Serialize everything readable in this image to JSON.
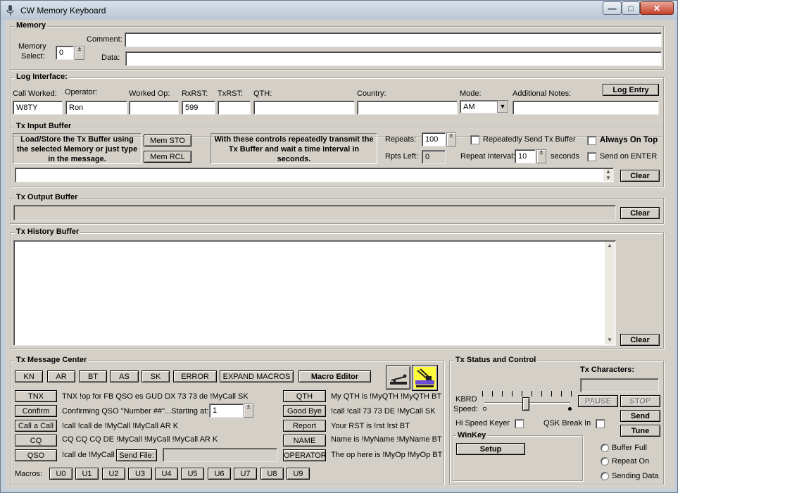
{
  "window": {
    "title": "CW Memory Keyboard",
    "minimize_glyph": "—",
    "maximize_glyph": "□",
    "close_glyph": "✕"
  },
  "memory": {
    "group_label": "Memory",
    "select_label_line1": "Memory",
    "select_label_line2": "Select:",
    "select_value": "0",
    "comment_label": "Comment:",
    "comment_value": "",
    "data_label": "Data:",
    "data_value": ""
  },
  "log": {
    "group_label": "Log Interface:",
    "log_entry_label": "Log Entry",
    "fields": {
      "call_worked_label": "Call Worked:",
      "call_worked_value": "W8TY",
      "operator_label": "Operator:",
      "operator_value": "Ron",
      "worked_op_label": "Worked Op:",
      "worked_op_value": "",
      "rxrst_label": "RxRST:",
      "rxrst_value": "599",
      "txrst_label": "TxRST:",
      "txrst_value": "",
      "qth_label": "QTH:",
      "qth_value": "",
      "country_label": "Country:",
      "country_value": "",
      "mode_label": "Mode:",
      "mode_value": "AM",
      "notes_label": "Additional Notes:",
      "notes_value": ""
    }
  },
  "tx_input": {
    "group_label": "Tx Input Buffer",
    "help_text": "Load/Store the Tx Buffer using the selected Memory  or just type in the message.",
    "mem_sto_label": "Mem STO",
    "mem_rcl_label": "Mem RCL",
    "repeat_help": "With these controls repeatedly transmit the Tx Buffer and wait a time interval in seconds.",
    "repeats_label": "Repeats:",
    "repeats_value": "100",
    "rpts_left_label": "Rpts Left:",
    "rpts_left_value": "0",
    "repeat_send_label": "Repeatedly Send Tx Buffer",
    "repeat_interval_label": "Repeat Interval:",
    "repeat_interval_value": "10",
    "seconds_label": "seconds",
    "always_on_top_label": "Always On Top",
    "send_on_enter_label": "Send on ENTER",
    "buffer_value": "",
    "clear_label": "Clear"
  },
  "tx_output": {
    "group_label": "Tx Output Buffer",
    "buffer_value": "",
    "clear_label": "Clear"
  },
  "tx_history": {
    "group_label": "Tx History Buffer",
    "buffer_value": "",
    "clear_label": "Clear"
  },
  "message_center": {
    "group_label": "Tx Message Center",
    "prosigns": [
      "KN",
      "AR",
      "BT",
      "AS",
      "SK",
      "ERROR",
      "EXPAND MACROS"
    ],
    "macro_editor_label": "Macro Editor",
    "left_messages": [
      {
        "button": "TNX",
        "text": "TNX !op for FB QSO es GUD DX 73 73  de !MyCall SK"
      },
      {
        "button": "Confirm",
        "text": "Confirming QSO \"Number ##\"...Starting at:"
      },
      {
        "button": "Call a Call",
        "text": "!call !call de !MyCall !MyCall AR K"
      },
      {
        "button": "CQ",
        "text": "CQ CQ CQ DE !MyCall !MyCall !MyCall AR K"
      },
      {
        "button": "QSO",
        "text": "!call de !MyCall"
      }
    ],
    "confirm_start_value": "1",
    "send_file_label": "Send File:",
    "send_file_value": "",
    "right_messages": [
      {
        "button": "QTH",
        "text": "My QTH is !MyQTH !MyQTH BT"
      },
      {
        "button": "Good Bye",
        "text": "!call !call 73 73 DE !MyCall SK"
      },
      {
        "button": "Report",
        "text": "Your RST is !rst !rst BT"
      },
      {
        "button": "NAME",
        "text": "Name is !MyName !MyName BT"
      },
      {
        "button": "OPERATOR",
        "text": "The op here is !MyOp !MyOp BT"
      }
    ],
    "macros_label": "Macros:",
    "macros": [
      "U0",
      "U1",
      "U2",
      "U3",
      "U4",
      "U5",
      "U6",
      "U7",
      "U8",
      "U9"
    ],
    "icons": [
      "straight-key-icon",
      "paddle-keyer-icon"
    ]
  },
  "tx_status": {
    "group_label": "Tx Status and Control",
    "tx_chars_label": "Tx Characters:",
    "tx_chars_value": "",
    "kbrd_label_line1": "KBRD",
    "kbrd_label_line2": "Speed:",
    "speed_level": 0.5,
    "pause_label": "PAUSE",
    "stop_label": "STOP",
    "send_label": "Send",
    "tune_label": "Tune",
    "hi_speed_label": "Hi Speed Keyer",
    "qsk_label": "QSK Break In",
    "winkey_label": "WinKey",
    "setup_label": "Setup",
    "indicators": [
      "Buffer Full",
      "Repeat On",
      "Sending Data"
    ]
  }
}
